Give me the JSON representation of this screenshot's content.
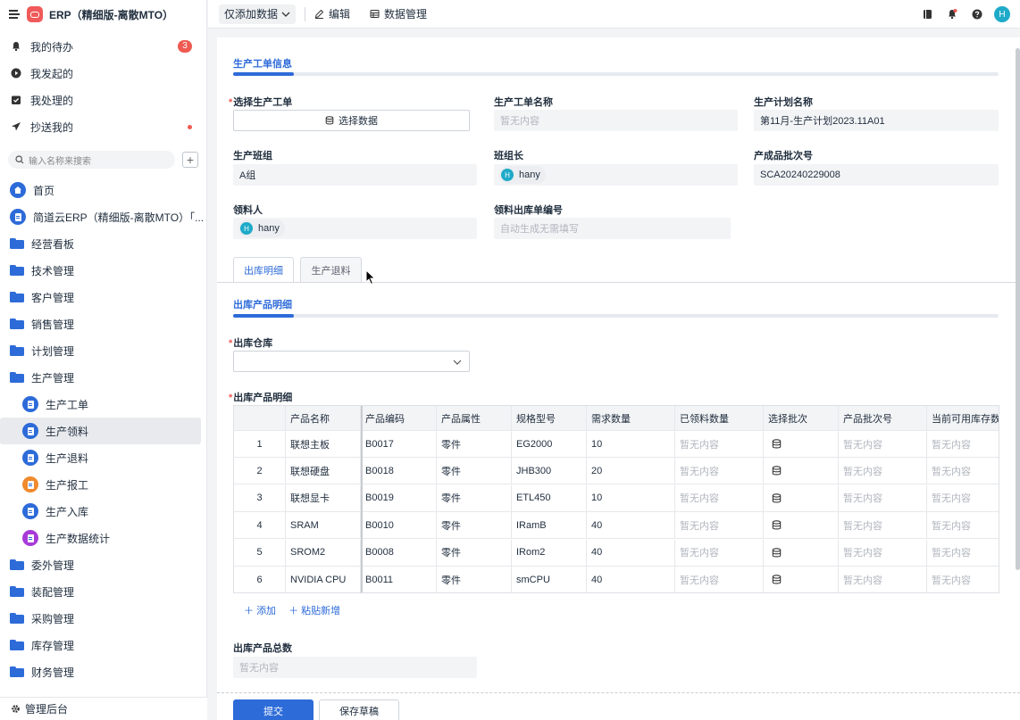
{
  "app": {
    "title": "ERP（精细版-离散MTO）"
  },
  "tasks": [
    {
      "label": "我的待办",
      "badge": "3"
    },
    {
      "label": "我发起的"
    },
    {
      "label": "我处理的"
    },
    {
      "label": "抄送我的"
    }
  ],
  "search": {
    "placeholder": "输入名称来搜索"
  },
  "nav": {
    "home": "首页",
    "app_root": "简道云ERP（精细版-离散MTO）「...",
    "folders_top": [
      "经营看板",
      "技术管理",
      "客户管理",
      "销售管理",
      "计划管理",
      "生产管理"
    ],
    "sub": [
      "生产工单",
      "生产领料",
      "生产退料",
      "生产报工",
      "生产入库",
      "生产数据统计"
    ],
    "folders_bottom": [
      "委外管理",
      "装配管理",
      "采购管理",
      "库存管理",
      "财务管理"
    ],
    "admin": "管理后台"
  },
  "topbar": {
    "dropdown": "仅添加数据",
    "edit": "编辑",
    "data_manage": "数据管理",
    "avatar": "H"
  },
  "form": {
    "section1": "生产工单信息",
    "select_order_label": "选择生产工单",
    "select_order_btn": "选择数据",
    "order_name_label": "生产工单名称",
    "order_name_value": "暂无内容",
    "plan_name_label": "生产计划名称",
    "plan_name_value": "第11月-生产计划2023.11A01",
    "team_label": "生产班组",
    "team_value": "A组",
    "leader_label": "班组长",
    "leader_value": "hany",
    "batch_label": "产成品批次号",
    "batch_value": "SCA20240229008",
    "picker_label": "领料人",
    "picker_value": "hany",
    "out_no_label": "领料出库单编号",
    "out_no_value": "自动生成无需填写",
    "tabs": [
      "出库明细",
      "生产退料"
    ],
    "section2": "出库产品明细",
    "warehouse_label": "出库仓库",
    "detail_label": "出库产品明细",
    "table_headers": [
      "产品名称",
      "产品编码",
      "产品属性",
      "规格型号",
      "需求数量",
      "已领料数量",
      "选择批次",
      "产品批次号",
      "当前可用库存数"
    ],
    "rows": [
      {
        "idx": "1",
        "name": "联想主板",
        "code": "B0017",
        "attr": "零件",
        "spec": "EG2000",
        "qty": "10",
        "taken": "暂无内容",
        "batch_no": "暂无内容",
        "stock": "暂无内容"
      },
      {
        "idx": "2",
        "name": "联想硬盘",
        "code": "B0018",
        "attr": "零件",
        "spec": "JHB300",
        "qty": "20",
        "taken": "暂无内容",
        "batch_no": "暂无内容",
        "stock": "暂无内容"
      },
      {
        "idx": "3",
        "name": "联想显卡",
        "code": "B0019",
        "attr": "零件",
        "spec": "ETL450",
        "qty": "10",
        "taken": "暂无内容",
        "batch_no": "暂无内容",
        "stock": "暂无内容"
      },
      {
        "idx": "4",
        "name": "SRAM",
        "code": "B0010",
        "attr": "零件",
        "spec": "IRamB",
        "qty": "40",
        "taken": "暂无内容",
        "batch_no": "暂无内容",
        "stock": "暂无内容"
      },
      {
        "idx": "5",
        "name": "SROM2",
        "code": "B0008",
        "attr": "零件",
        "spec": "IRom2",
        "qty": "40",
        "taken": "暂无内容",
        "batch_no": "暂无内容",
        "stock": "暂无内容"
      },
      {
        "idx": "6",
        "name": "NVIDIA CPU",
        "code": "B0011",
        "attr": "零件",
        "spec": "smCPU",
        "qty": "40",
        "taken": "暂无内容",
        "batch_no": "暂无内容",
        "stock": "暂无内容"
      }
    ],
    "add_label": "添加",
    "paste_label": "粘贴新增",
    "total_label": "出库产品总数",
    "total_value": "暂无内容"
  },
  "footer": {
    "submit": "提交",
    "save_draft": "保存草稿"
  },
  "colors": {
    "accent": "#2d6bd8",
    "badge": "#ee5a52"
  }
}
